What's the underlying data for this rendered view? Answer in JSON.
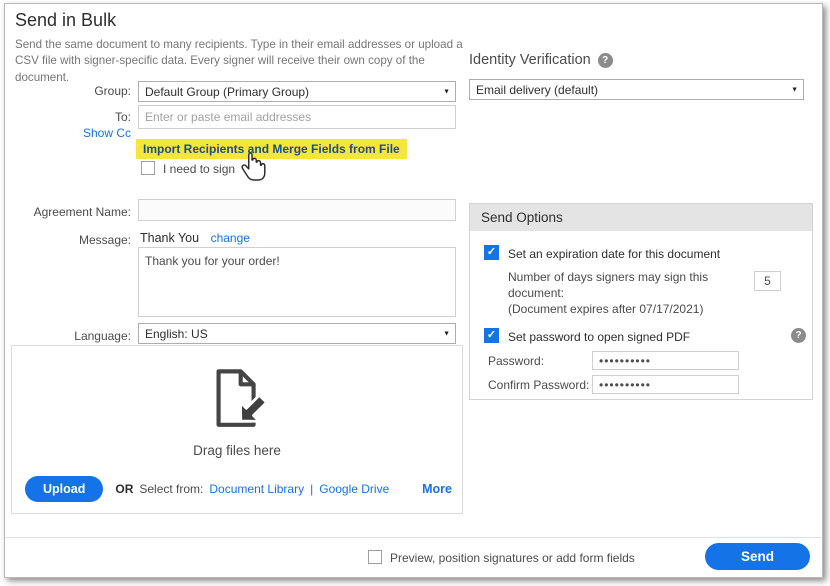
{
  "icons": {
    "help": "?",
    "check": "✓",
    "caret": "▼"
  },
  "colors": {
    "accent": "#1473e6",
    "highlight": "#f6e63a",
    "link_on_highlight": "#174f8f"
  },
  "header": {
    "title": "Send in Bulk",
    "subtitle": "Send the same document to many recipients. Type in their email addresses or upload a CSV file with signer-specific data. Every signer will receive their own copy of the document."
  },
  "identity": {
    "label": "Identity Verification",
    "selected": "Email delivery (default)"
  },
  "form": {
    "group_label": "Group:",
    "group_value": "Default Group (Primary Group)",
    "to_label": "To:",
    "to_placeholder": "Enter or paste email addresses",
    "show_cc": "Show Cc",
    "import_link": "Import Recipients and Merge Fields from File",
    "need_to_sign": "I need to sign",
    "agreement_label": "Agreement Name:",
    "message_label": "Message:",
    "message_title": "Thank You",
    "change_link": "change",
    "message_body": "Thank you for your order!",
    "language_label": "Language:",
    "language_value": "English: US"
  },
  "files": {
    "drag_text": "Drag files here",
    "upload_button": "Upload",
    "or_label": "OR",
    "select_from": "Select from:",
    "document_library": "Document Library",
    "separator": "|",
    "google_drive": "Google Drive",
    "more": "More"
  },
  "send_options": {
    "title": "Send Options",
    "expiration_checkbox": "Set an expiration date for this document",
    "days_label": "Number of days signers may sign this document:",
    "days_value": "5",
    "expires_note": "(Document expires after 07/17/2021)",
    "password_checkbox": "Set password to open signed PDF",
    "password_label": "Password:",
    "password_value": "••••••••••",
    "confirm_label": "Confirm Password:",
    "confirm_value": "••••••••••"
  },
  "footer": {
    "preview_checkbox": "Preview, position signatures or add form fields",
    "send_button": "Send"
  }
}
